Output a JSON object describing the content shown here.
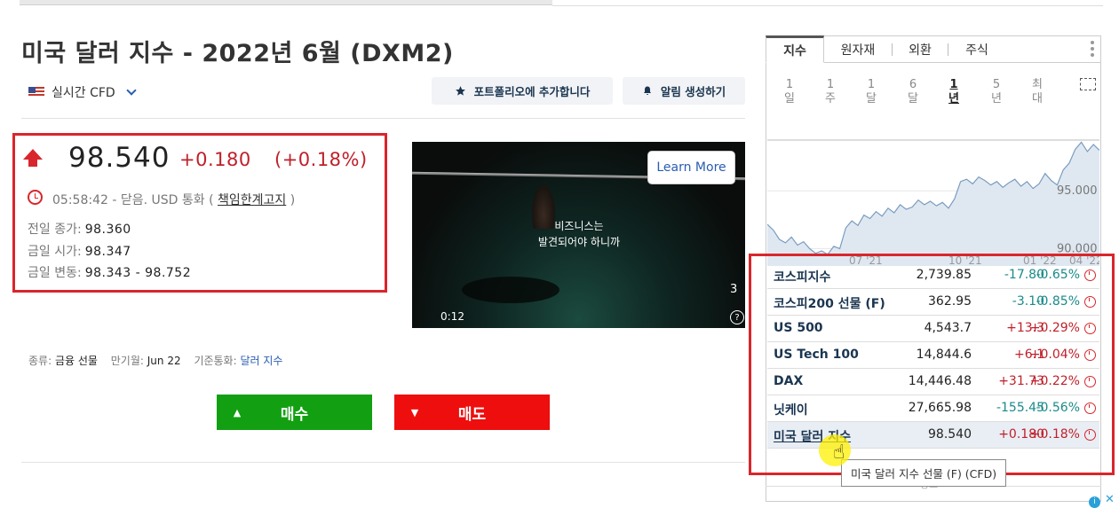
{
  "page": {
    "title": "미국 달러 지수 - 2022년 6월 (DXM2)"
  },
  "header": {
    "cfd_label": "실시간 CFD",
    "portfolio_label": "포트폴리오에 추가합니다",
    "alert_label": "알림 생성하기"
  },
  "quote": {
    "price": "98.540",
    "change": "+0.180",
    "change_pct": "(+0.18%)",
    "time_status": "05:58:42 - 닫음. USD 통화 (",
    "disclaimer": "책임한계고지",
    "time_tail": ")",
    "prev_close_label": "전일 종가:",
    "prev_close": "98.360",
    "open_label": "금일 시가:",
    "open": "98.347",
    "range_label": "금일 변동:",
    "range": "98.343 - 98.752"
  },
  "video": {
    "learn_more": "Learn More",
    "caption_line1": "비즈니스는",
    "caption_line2": "발견되어야 하니까",
    "time": "0:12",
    "count": "3",
    "help": "?"
  },
  "meta": {
    "type_label": "종류:",
    "type_value": "금융 선물",
    "expiry_label": "만기월:",
    "expiry_value": "Jun 22",
    "base_label": "기준통화:",
    "base_value": "달러 지수"
  },
  "trade": {
    "buy_label": "매수",
    "sell_label": "매도"
  },
  "panel": {
    "tabs": [
      "지수",
      "원자재",
      "외환",
      "주식"
    ],
    "periods": [
      {
        "top": "1",
        "bottom": "일"
      },
      {
        "top": "1",
        "bottom": "주"
      },
      {
        "top": "1",
        "bottom": "달"
      },
      {
        "top": "6",
        "bottom": "달"
      },
      {
        "top": "1",
        "bottom": "년"
      },
      {
        "top": "5",
        "bottom": "년"
      },
      {
        "top": "최",
        "bottom": "대"
      }
    ],
    "active_period": 4
  },
  "chart_data": {
    "type": "area",
    "x_ticks": [
      "07 '21",
      "10 '21",
      "01 '22",
      "04 '22"
    ],
    "y_ticks": [
      "95.000",
      "90.000"
    ],
    "ylim": [
      88.5,
      100.0
    ],
    "values": [
      92.1,
      91.6,
      90.8,
      90.5,
      91.0,
      90.3,
      90.6,
      90.0,
      89.6,
      89.8,
      89.5,
      90.2,
      90.0,
      91.8,
      92.4,
      92.0,
      92.9,
      92.6,
      93.2,
      92.8,
      93.5,
      93.1,
      93.8,
      93.4,
      93.6,
      94.2,
      93.8,
      94.1,
      93.7,
      94.0,
      93.5,
      94.3,
      95.8,
      96.0,
      95.6,
      96.2,
      95.9,
      95.5,
      95.8,
      95.3,
      95.7,
      96.0,
      95.4,
      95.8,
      95.2,
      95.6,
      96.5,
      95.9,
      95.5,
      96.8,
      97.4,
      98.6,
      99.2,
      98.4,
      99.0,
      98.5
    ]
  },
  "indices": [
    {
      "name": "코스피지수",
      "price": "2,739.85",
      "change": "-17.80",
      "pct": "-0.65%",
      "dir": "neg"
    },
    {
      "name": "코스피200 선물 (F)",
      "price": "362.95",
      "change": "-3.10",
      "pct": "-0.85%",
      "dir": "neg"
    },
    {
      "name": "US 500",
      "price": "4,543.7",
      "change": "+13.3",
      "pct": "+0.29%",
      "dir": "pos"
    },
    {
      "name": "US Tech 100",
      "price": "14,844.6",
      "change": "+6.1",
      "pct": "+0.04%",
      "dir": "pos"
    },
    {
      "name": "DAX",
      "price": "14,446.48",
      "change": "+31.73",
      "pct": "+0.22%",
      "dir": "pos"
    },
    {
      "name": "닛케이",
      "price": "27,665.98",
      "change": "-155.45",
      "pct": "-0.56%",
      "dir": "neg"
    },
    {
      "name": "미국 달러 지수",
      "price": "98.540",
      "change": "+0.180",
      "pct": "+0.18%",
      "dir": "pos"
    }
  ],
  "tooltip": "미국 달러 지수 선물 (F) (CFD)",
  "ad": {
    "label": "광고"
  },
  "colors": {
    "up": "#c0202a",
    "down": "#1a8a8a",
    "buy": "#12a012",
    "sell": "#ee0e0e",
    "highlight_box": "#d9262c",
    "link": "#2a5db0"
  }
}
